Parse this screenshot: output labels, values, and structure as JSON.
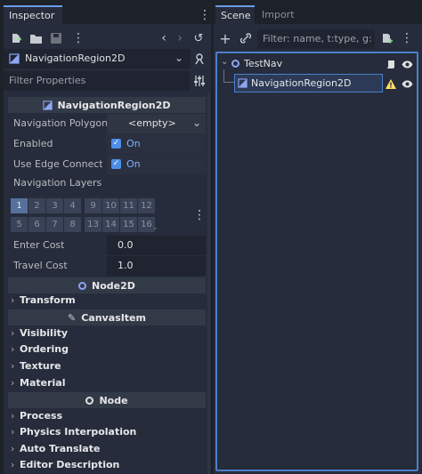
{
  "inspector": {
    "tab_label": "Inspector",
    "object_name": "NavigationRegion2D",
    "filter_placeholder": "Filter Properties",
    "sections": {
      "navigation_region": "NavigationRegion2D",
      "node2d": "Node2D",
      "canvas_item": "CanvasItem",
      "node": "Node"
    },
    "properties": {
      "navigation_polygon": {
        "label": "Navigation Polygon",
        "value": "<empty>"
      },
      "enabled": {
        "label": "Enabled",
        "value": "On"
      },
      "use_edge_connections": {
        "label": "Use Edge Connectio",
        "value": "On"
      },
      "navigation_layers": {
        "label": "Navigation Layers"
      },
      "enter_cost": {
        "label": "Enter Cost",
        "value": "0.0"
      },
      "travel_cost": {
        "label": "Travel Cost",
        "value": "1.0"
      }
    },
    "layers": [
      "1",
      "2",
      "3",
      "4",
      "9",
      "10",
      "11",
      "12",
      "5",
      "6",
      "7",
      "8",
      "13",
      "14",
      "15",
      "16"
    ],
    "groups": {
      "transform": "Transform",
      "visibility": "Visibility",
      "ordering": "Ordering",
      "texture": "Texture",
      "material": "Material",
      "process": "Process",
      "physics_interpolation": "Physics Interpolation",
      "auto_translate": "Auto Translate",
      "editor_description": "Editor Description"
    }
  },
  "scene": {
    "tab_scene": "Scene",
    "tab_import": "Import",
    "filter_placeholder": "Filter: name, t:type, g:",
    "tree": {
      "root": "TestNav",
      "child": "NavigationRegion2D"
    }
  },
  "colors": {
    "accent": "#699ce8",
    "node2d": "#8da5f3",
    "warning": "#ffdd65",
    "checkbox": "#4d8ee6"
  }
}
